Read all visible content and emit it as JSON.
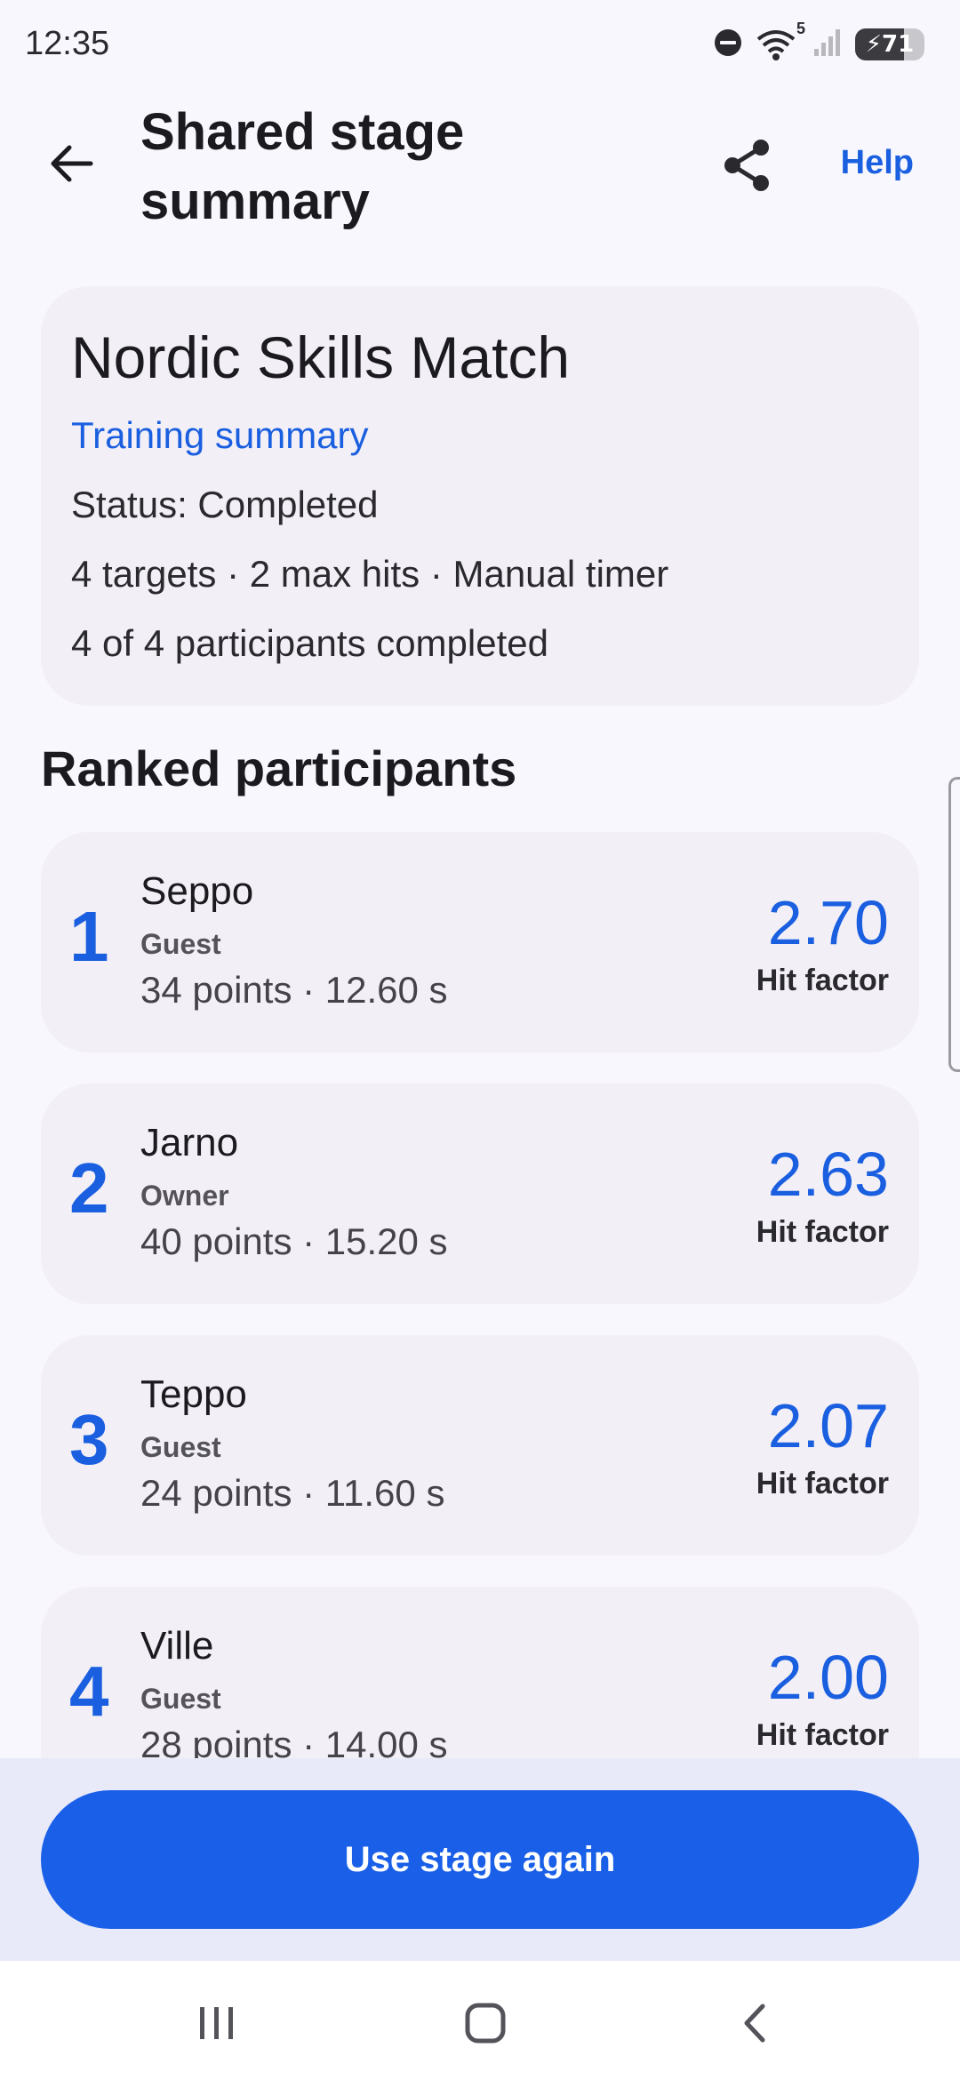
{
  "status_bar": {
    "time": "12:35",
    "battery_level": "71",
    "battery_fraction": 0.71,
    "wifi_badge": "5",
    "icons": [
      "do-not-disturb-icon",
      "wifi-icon",
      "signal-icon",
      "battery-charging-icon"
    ]
  },
  "app_bar": {
    "title": "Shared stage summary",
    "back_icon": "arrow-left-icon",
    "share_icon": "share-icon",
    "help_label": "Help"
  },
  "summary": {
    "match_name": "Nordic Skills Match",
    "link_label": "Training summary",
    "status": "Status: Completed",
    "config": "4 targets · 2 max hits · Manual timer",
    "progress": "4 of 4 participants completed"
  },
  "ranking": {
    "section_title": "Ranked participants",
    "participants": [
      {
        "rank": "1",
        "name": "Seppo",
        "role": "Guest",
        "stats": "34 points · 12.60 s",
        "hit_factor": "2.70",
        "hit_label": "Hit factor"
      },
      {
        "rank": "2",
        "name": "Jarno",
        "role": "Owner",
        "stats": "40 points · 15.20 s",
        "hit_factor": "2.63",
        "hit_label": "Hit factor"
      },
      {
        "rank": "3",
        "name": "Teppo",
        "role": "Guest",
        "stats": "24 points · 11.60 s",
        "hit_factor": "2.07",
        "hit_label": "Hit factor"
      },
      {
        "rank": "4",
        "name": "Ville",
        "role": "Guest",
        "stats": "28 points · 14.00 s",
        "hit_factor": "2.00",
        "hit_label": "Hit factor"
      }
    ]
  },
  "actions": {
    "primary_label": "Use stage again"
  },
  "nav_bar": {
    "icons": [
      "recent-apps-icon",
      "home-icon",
      "back-icon"
    ]
  },
  "colors": {
    "accent": "#1a5fe0",
    "card_bg": "#f3eff6",
    "page_bg": "#f8f7fd",
    "button_bg": "#1a5fe8"
  }
}
